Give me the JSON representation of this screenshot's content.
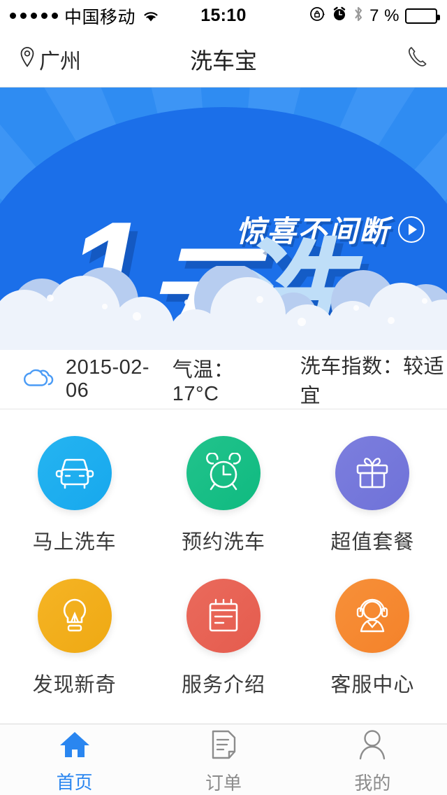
{
  "statusbar": {
    "carrier": "中国移动",
    "signal_dots": 5,
    "wifi_icon": "wifi-icon",
    "time": "15:10",
    "rotation_lock_icon": "rotation-lock-icon",
    "alarm_icon": "alarm-clock-icon",
    "bluetooth_icon": "bluetooth-icon",
    "battery_percent": "7 %",
    "battery_level": 7,
    "battery_color": "#ff2b20"
  },
  "navbar": {
    "location_icon": "location-pin-icon",
    "location": "广州",
    "title": "洗车宝",
    "phone_icon": "phone-icon"
  },
  "banner": {
    "tagline": "惊喜不间断",
    "play_icon": "play-circle-icon",
    "headline_number": "1",
    "headline_unit": "元",
    "headline_action": "洗车",
    "bg_color": "#2f8cf2",
    "ellipse_color": "#1b6fe9",
    "ray_color": "#3d95f5",
    "headline_white": "#ffffff",
    "headline_lightblue": "#bfdef8"
  },
  "weather": {
    "icon": "cloud-icon",
    "icon_color": "#4a9bf5",
    "date": "2015-02-06",
    "temperature": "气温：17°C",
    "wash_index": "洗车指数：较适宜"
  },
  "grid": {
    "items": [
      {
        "label": "马上洗车",
        "icon": "car-icon",
        "color": "#19aeee"
      },
      {
        "label": "预约洗车",
        "icon": "alarm-icon",
        "color": "#13bd84"
      },
      {
        "label": "超值套餐",
        "icon": "gift-icon",
        "color": "#7275da"
      },
      {
        "label": "发现新奇",
        "icon": "lightbulb-icon",
        "color": "#f1ab16"
      },
      {
        "label": "服务介绍",
        "icon": "calendar-icon",
        "color": "#e65f51"
      },
      {
        "label": "客服中心",
        "icon": "headset-icon",
        "color": "#f5852c"
      }
    ]
  },
  "tabbar": {
    "active_color": "#2a86f0",
    "inactive_color": "#8c8c8c",
    "tabs": [
      {
        "label": "首页",
        "icon": "home-icon",
        "active": true
      },
      {
        "label": "订单",
        "icon": "document-icon",
        "active": false
      },
      {
        "label": "我的",
        "icon": "person-icon",
        "active": false
      }
    ]
  }
}
